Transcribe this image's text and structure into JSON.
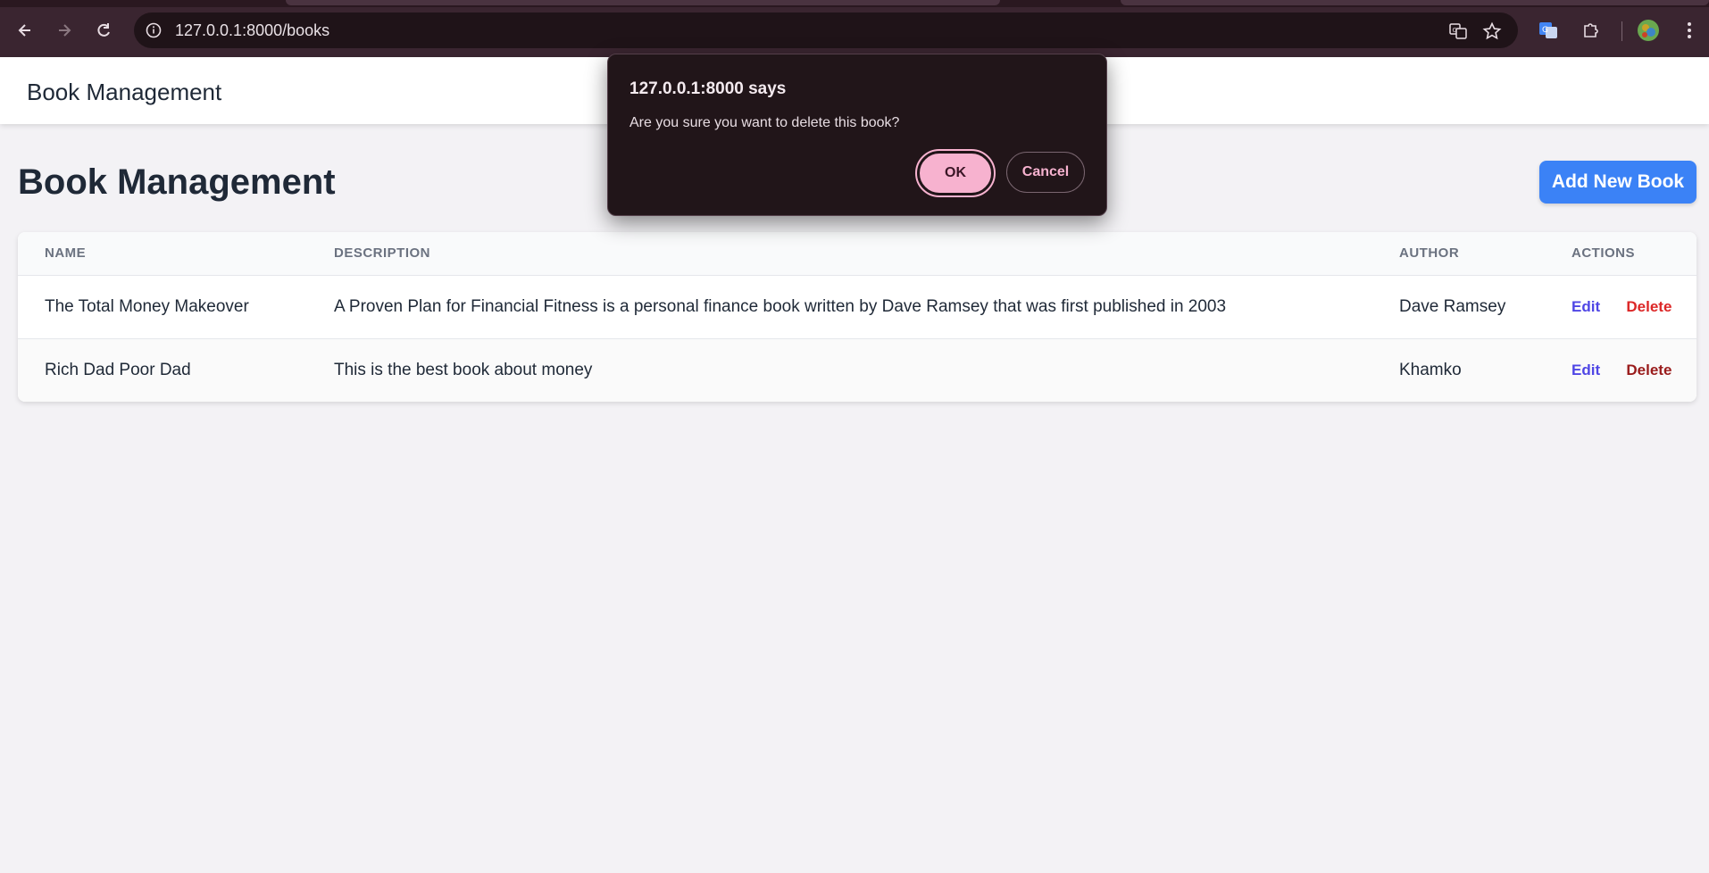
{
  "browser": {
    "url": "127.0.0.1:8000/books",
    "icons": [
      "back-icon",
      "forward-icon",
      "reload-icon",
      "site-info-icon",
      "translate-icon",
      "bookmark-star-icon",
      "google-translate-extension-icon",
      "extensions-puzzle-icon",
      "profile-avatar",
      "more-vert-icon"
    ]
  },
  "app": {
    "brand": "Book Management",
    "page_title": "Book Management",
    "add_button": "Add New Book",
    "table": {
      "headers": [
        "NAME",
        "DESCRIPTION",
        "AUTHOR",
        "ACTIONS"
      ],
      "rows": [
        {
          "name": "The Total Money Makeover",
          "description": "A Proven Plan for Financial Fitness is a personal finance book written by Dave Ramsey that was first published in 2003",
          "author": "Dave Ramsey",
          "edit": "Edit",
          "delete": "Delete"
        },
        {
          "name": "Rich Dad Poor Dad",
          "description": "This is the best book about money",
          "author": "Khamko",
          "edit": "Edit",
          "delete": "Delete"
        }
      ]
    }
  },
  "dialog": {
    "origin": "127.0.0.1:8000 says",
    "message": "Are you sure you want to delete this book?",
    "ok": "OK",
    "cancel": "Cancel"
  },
  "colors": {
    "primary": "#3b82f6",
    "edit": "#4f46e5",
    "delete": "#dc2626",
    "dialog_accent": "#f7b2cf"
  }
}
